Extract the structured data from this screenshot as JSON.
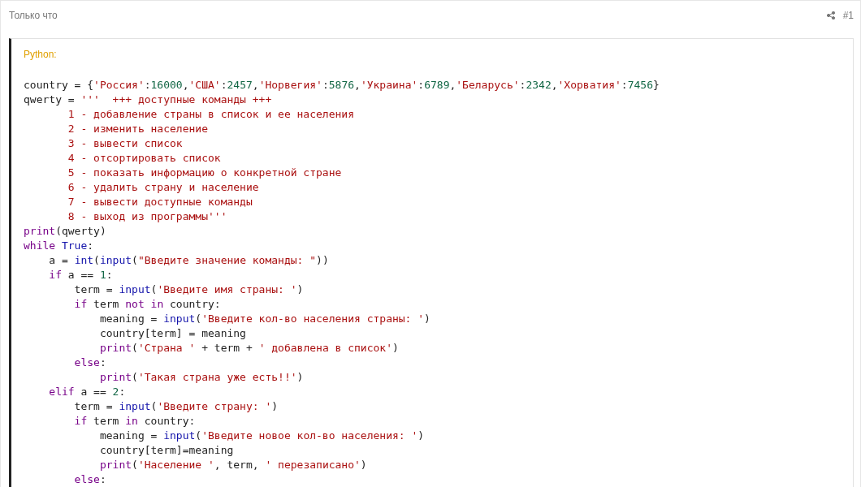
{
  "post": {
    "time": "Только что",
    "number": "#1"
  },
  "code": {
    "language": "Python:",
    "lines": [
      [
        {
          "kind": "plain",
          "text": "country = {"
        },
        {
          "kind": "string",
          "text": "'Россия'"
        },
        {
          "kind": "plain",
          "text": ":"
        },
        {
          "kind": "number",
          "text": "16000"
        },
        {
          "kind": "plain",
          "text": ","
        },
        {
          "kind": "string",
          "text": "'США'"
        },
        {
          "kind": "plain",
          "text": ":"
        },
        {
          "kind": "number",
          "text": "2457"
        },
        {
          "kind": "plain",
          "text": ","
        },
        {
          "kind": "string",
          "text": "'Норвегия'"
        },
        {
          "kind": "plain",
          "text": ":"
        },
        {
          "kind": "number",
          "text": "5876"
        },
        {
          "kind": "plain",
          "text": ","
        },
        {
          "kind": "string",
          "text": "'Украина'"
        },
        {
          "kind": "plain",
          "text": ":"
        },
        {
          "kind": "number",
          "text": "6789"
        },
        {
          "kind": "plain",
          "text": ","
        },
        {
          "kind": "string",
          "text": "'Беларусь'"
        },
        {
          "kind": "plain",
          "text": ":"
        },
        {
          "kind": "number",
          "text": "2342"
        },
        {
          "kind": "plain",
          "text": ","
        },
        {
          "kind": "string",
          "text": "'Хорватия'"
        },
        {
          "kind": "plain",
          "text": ":"
        },
        {
          "kind": "number",
          "text": "7456"
        },
        {
          "kind": "plain",
          "text": "}"
        }
      ],
      [
        {
          "kind": "plain",
          "text": "qwerty = "
        },
        {
          "kind": "string",
          "text": "'''  +++ доступные команды +++"
        }
      ],
      [
        {
          "kind": "string",
          "text": "       1 - добавление страны в список и ее населения"
        }
      ],
      [
        {
          "kind": "string",
          "text": "       2 - изменить население"
        }
      ],
      [
        {
          "kind": "string",
          "text": "       3 - вывести список"
        }
      ],
      [
        {
          "kind": "string",
          "text": "       4 - отсортировать список"
        }
      ],
      [
        {
          "kind": "string",
          "text": "       5 - показать информацию о конкретной стране"
        }
      ],
      [
        {
          "kind": "string",
          "text": "       6 - удалить страну и население"
        }
      ],
      [
        {
          "kind": "string",
          "text": "       7 - вывести доступные команды"
        }
      ],
      [
        {
          "kind": "string",
          "text": "       8 - выход из программы'''"
        }
      ],
      [
        {
          "kind": "keyword",
          "text": "print"
        },
        {
          "kind": "plain",
          "text": "(qwerty)"
        }
      ],
      [
        {
          "kind": "keyword",
          "text": "while "
        },
        {
          "kind": "builtin",
          "text": "True"
        },
        {
          "kind": "plain",
          "text": ":"
        }
      ],
      [
        {
          "kind": "plain",
          "text": "    a = "
        },
        {
          "kind": "builtin",
          "text": "int"
        },
        {
          "kind": "plain",
          "text": "("
        },
        {
          "kind": "builtin",
          "text": "input"
        },
        {
          "kind": "plain",
          "text": "("
        },
        {
          "kind": "string",
          "text": "\"Введите значение команды: \""
        },
        {
          "kind": "plain",
          "text": "))"
        }
      ],
      [
        {
          "kind": "keyword",
          "text": "    if"
        },
        {
          "kind": "plain",
          "text": " a == "
        },
        {
          "kind": "number",
          "text": "1"
        },
        {
          "kind": "plain",
          "text": ":"
        }
      ],
      [
        {
          "kind": "plain",
          "text": "        term = "
        },
        {
          "kind": "builtin",
          "text": "input"
        },
        {
          "kind": "plain",
          "text": "("
        },
        {
          "kind": "string",
          "text": "'Введите имя страны: '"
        },
        {
          "kind": "plain",
          "text": ")"
        }
      ],
      [
        {
          "kind": "keyword",
          "text": "        if"
        },
        {
          "kind": "plain",
          "text": " term "
        },
        {
          "kind": "keyword",
          "text": "not in"
        },
        {
          "kind": "plain",
          "text": " country:"
        }
      ],
      [
        {
          "kind": "plain",
          "text": "            meaning = "
        },
        {
          "kind": "builtin",
          "text": "input"
        },
        {
          "kind": "plain",
          "text": "("
        },
        {
          "kind": "string",
          "text": "'Введите кол-во населения страны: '"
        },
        {
          "kind": "plain",
          "text": ")"
        }
      ],
      [
        {
          "kind": "plain",
          "text": "            country[term] = meaning"
        }
      ],
      [
        {
          "kind": "keyword",
          "text": "            print"
        },
        {
          "kind": "plain",
          "text": "("
        },
        {
          "kind": "string",
          "text": "'Страна '"
        },
        {
          "kind": "plain",
          "text": " + term + "
        },
        {
          "kind": "string",
          "text": "' добавлена в список'"
        },
        {
          "kind": "plain",
          "text": ")"
        }
      ],
      [
        {
          "kind": "keyword",
          "text": "        else"
        },
        {
          "kind": "plain",
          "text": ":"
        }
      ],
      [
        {
          "kind": "keyword",
          "text": "            print"
        },
        {
          "kind": "plain",
          "text": "("
        },
        {
          "kind": "string",
          "text": "'Такая страна уже есть!!'"
        },
        {
          "kind": "plain",
          "text": ")"
        }
      ],
      [
        {
          "kind": "keyword",
          "text": "    elif"
        },
        {
          "kind": "plain",
          "text": " a == "
        },
        {
          "kind": "number",
          "text": "2"
        },
        {
          "kind": "plain",
          "text": ":"
        }
      ],
      [
        {
          "kind": "plain",
          "text": "        term = "
        },
        {
          "kind": "builtin",
          "text": "input"
        },
        {
          "kind": "plain",
          "text": "("
        },
        {
          "kind": "string",
          "text": "'Введите страну: '"
        },
        {
          "kind": "plain",
          "text": ")"
        }
      ],
      [
        {
          "kind": "keyword",
          "text": "        if"
        },
        {
          "kind": "plain",
          "text": " term "
        },
        {
          "kind": "keyword",
          "text": "in"
        },
        {
          "kind": "plain",
          "text": " country:"
        }
      ],
      [
        {
          "kind": "plain",
          "text": "            meaning = "
        },
        {
          "kind": "builtin",
          "text": "input"
        },
        {
          "kind": "plain",
          "text": "("
        },
        {
          "kind": "string",
          "text": "'Введите новое кол-во населения: '"
        },
        {
          "kind": "plain",
          "text": ")"
        }
      ],
      [
        {
          "kind": "plain",
          "text": "            country[term]=meaning"
        }
      ],
      [
        {
          "kind": "keyword",
          "text": "            print"
        },
        {
          "kind": "plain",
          "text": "("
        },
        {
          "kind": "string",
          "text": "'Население '"
        },
        {
          "kind": "plain",
          "text": ", term, "
        },
        {
          "kind": "string",
          "text": "' перезаписано'"
        },
        {
          "kind": "plain",
          "text": ")"
        }
      ],
      [
        {
          "kind": "keyword",
          "text": "        else"
        },
        {
          "kind": "plain",
          "text": ":"
        }
      ]
    ]
  }
}
